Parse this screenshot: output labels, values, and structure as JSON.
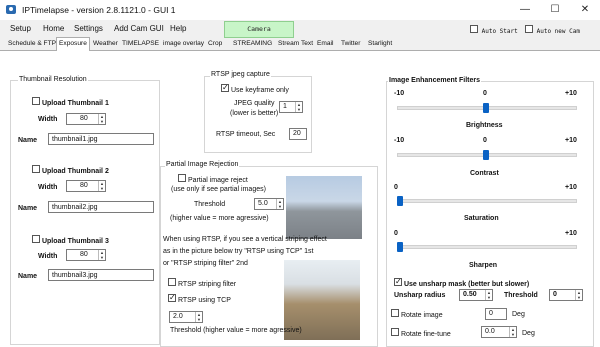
{
  "window": {
    "title": "IPTimelapse - version 2.8.1121.0 -   GUI 1",
    "minimize_glyph": "—",
    "maximize_glyph": "☐",
    "close_glyph": "✕"
  },
  "menu": {
    "items": [
      "Setup",
      "Home",
      "Settings",
      "Add Cam GUI",
      "Help"
    ],
    "camera_button": "Camera",
    "auto_start": "Auto Start",
    "auto_new_cam": "Auto new Cam"
  },
  "tabs": [
    "Schedule & FTP",
    "Exposure",
    "Weather",
    "TIMELAPSE",
    "image overlay",
    "Crop",
    "STREAMING",
    "Stream Text",
    "Email",
    "Twitter",
    "Starlight"
  ],
  "active_tab": "Exposure",
  "thumbnails": {
    "group_title": "Thumbnail Resolution",
    "items": [
      {
        "checkbox_label": "Upload Thumbnail 1",
        "width_label": "Width",
        "width": "80",
        "name_label": "Name",
        "name": "thumbnail1.jpg"
      },
      {
        "checkbox_label": "Upload Thumbnail 2",
        "width_label": "Width",
        "width": "80",
        "name_label": "Name",
        "name": "thumbnail2.jpg"
      },
      {
        "checkbox_label": "Upload Thumbnail 3",
        "width_label": "Width",
        "width": "80",
        "name_label": "Name",
        "name": "thumbnail3.jpg"
      }
    ]
  },
  "rtsp": {
    "group_title": "RTSP jpeg capture",
    "keyframe_label": "Use keyframe only",
    "keyframe_checked": true,
    "quality_label_1": "JPEG quality",
    "quality_label_2": "(lower is better)",
    "quality": "1",
    "timeout_label": "RTSP timeout, Sec",
    "timeout": "20"
  },
  "partial": {
    "group_title": "Partial Image Rejection",
    "reject_label_1": "Partial image reject",
    "reject_label_2": "(use only if see partial images)",
    "threshold_label": "Threshold",
    "threshold": "5.0",
    "threshold_hint": "(higher value = more agressive)",
    "rtsp_note_1": "When using RTSP, if you see a vertical striping effect",
    "rtsp_note_2": "as in the picture below try \"RTSP using TCP\" 1st",
    "rtsp_note_3": "or \"RTSP striping filter\" 2nd",
    "striping_filter_label": "RTSP striping filter",
    "striping_filter_checked": false,
    "tcp_label": "RTSP using TCP",
    "tcp_checked": true,
    "threshold2": "2.0",
    "threshold2_label": "Threshold (higher value = more agressive)"
  },
  "enhance": {
    "group_title": "Image Enhancement Filters",
    "sliders": [
      {
        "label": "Brightness",
        "min": "-10",
        "mid": "0",
        "max": "+10",
        "value": 0
      },
      {
        "label": "Contrast",
        "min": "-10",
        "mid": "0",
        "max": "+10",
        "value": 0
      },
      {
        "label": "Saturation",
        "min": "0",
        "mid": "",
        "max": "+10",
        "value": 0
      },
      {
        "label": "Sharpen",
        "min": "0",
        "mid": "",
        "max": "+10",
        "value": 0
      }
    ],
    "unsharp_label": "Use unsharp mask (better but slower)",
    "unsharp_checked": true,
    "radius_label": "Unsharp radius",
    "radius": "0.50",
    "threshold_label": "Threshold",
    "threshold": "0",
    "rotate_label": "Rotate image",
    "rotate_value": "0",
    "rotate_unit": "Deg",
    "finetune_label": "Rotate fine-tune",
    "finetune_value": "0.0",
    "finetune_unit": "Deg"
  }
}
